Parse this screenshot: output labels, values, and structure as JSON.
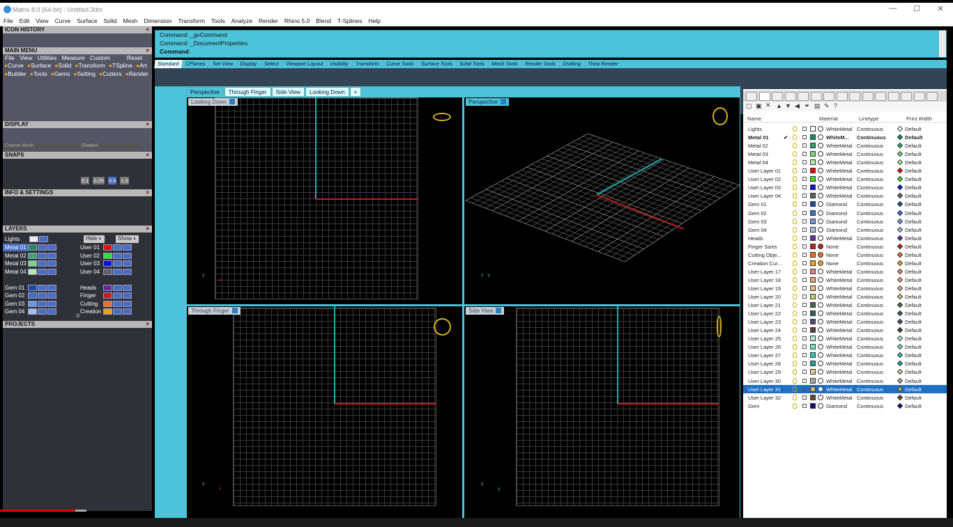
{
  "window": {
    "title": "Matrix 8.0 (64-bit) - Untitled.3dm",
    "controls": [
      "—",
      "☐",
      "✕"
    ]
  },
  "menubar": [
    "File",
    "Edit",
    "View",
    "Curve",
    "Surface",
    "Solid",
    "Mesh",
    "Dimension",
    "Transform",
    "Tools",
    "Analyze",
    "Render",
    "Rhino 5.0",
    "Blend",
    "T-Splines",
    "Help"
  ],
  "left": {
    "icon_history": "ICON HISTORY",
    "main_menu": "MAIN MENU",
    "main_menu_items": [
      "File",
      "View",
      "Utilities",
      "Measure",
      "Custom"
    ],
    "reset": "Reset",
    "menu_row2": [
      "Curve",
      "Surface",
      "Solid",
      "Transform",
      "TSpline",
      "Art"
    ],
    "menu_row3": [
      "Builder",
      "Tools",
      "Gems",
      "Setting",
      "Cutters",
      "Render"
    ],
    "display": "DISPLAY",
    "display_mode1": "Coarse Mesh",
    "display_mode2": "Shaded",
    "snaps": "SNAPS",
    "snap_values": [
      "0.1",
      "0.25",
      "0.5",
      "1.0"
    ],
    "info": "INFO & SETTINGS",
    "layers": "LAYERS",
    "lights": "Lights",
    "hide": "Hide",
    "show": "Show",
    "layer_left": [
      "Metal 01",
      "Metal 02",
      "Metal 03",
      "Metal 04",
      "",
      "Gem 01",
      "Gem 02",
      "Gem 03",
      "Gem 04"
    ],
    "layer_right": [
      "User 01",
      "User 02",
      "User 03",
      "User 04",
      "",
      "Heads",
      "Finger",
      "Cutting",
      "Creation"
    ],
    "projects": "PROJECTS"
  },
  "command": {
    "lines": [
      "Command: _gvCommand",
      "Command: _DocumentProperties",
      "Command:"
    ]
  },
  "toolbar_tabs": [
    "Standard",
    "CPlanes",
    "Set View",
    "Display",
    "Select",
    "Viewport Layout",
    "Visibility",
    "Transform",
    "Curve Tools",
    "Surface Tools",
    "Solid Tools",
    "Mesh Tools",
    "Render Tools",
    "Drafting",
    "Thea Render"
  ],
  "viewport_tabs": [
    "Perspective",
    "Through Finger",
    "Side View",
    "Looking Down",
    "+"
  ],
  "viewports": {
    "tl": {
      "label": "Looking Down",
      "ax1": "y",
      "ax2": "x"
    },
    "tr": {
      "label": "Perspective",
      "ax1": "z",
      "ax2": "y"
    },
    "bl": {
      "label": "Through Finger",
      "ax1": "z",
      "ax2": "x"
    },
    "br": {
      "label": "Side View",
      "ax1": "z",
      "ax2": "y"
    }
  },
  "layers_panel": {
    "headers": [
      "Name",
      "Material",
      "Linetype",
      "Print Width"
    ],
    "rows": [
      {
        "name": "Lights",
        "color": "#ffffff",
        "mat": "WhiteMetal",
        "lt": "Continuous",
        "pw": "Default",
        "dc": "#ffffff"
      },
      {
        "name": "Metal 01",
        "check": "✔",
        "color": "#1a8a5a",
        "mat": "WhiteM...",
        "lt": "Continuous",
        "pw": "Default",
        "dc": "#1a8a5a",
        "bold": true
      },
      {
        "name": "Metal 02",
        "color": "#2aa86a",
        "mat": "WhiteMetal",
        "lt": "Continuous",
        "pw": "Default",
        "dc": "#2aa86a"
      },
      {
        "name": "Metal 03",
        "color": "#7ad87a",
        "mat": "WhiteMetal",
        "lt": "Continuous",
        "pw": "Default",
        "dc": "#7ad87a"
      },
      {
        "name": "Metal 04",
        "color": "#b8e8a8",
        "mat": "WhiteMetal",
        "lt": "Continuous",
        "pw": "Default",
        "dc": "#b8e8a8"
      },
      {
        "name": "User Layer 01",
        "color": "#e01010",
        "mat": "WhiteMetal",
        "lt": "Continuous",
        "pw": "Default",
        "dc": "#e01010"
      },
      {
        "name": "User Layer 02",
        "color": "#30e030",
        "mat": "WhiteMetal",
        "lt": "Continuous",
        "pw": "Default",
        "dc": "#30e030"
      },
      {
        "name": "User Layer 03",
        "color": "#1010d0",
        "mat": "WhiteMetal",
        "lt": "Continuous",
        "pw": "Default",
        "dc": "#1010d0"
      },
      {
        "name": "User Layer 04",
        "color": "#606060",
        "mat": "WhiteMetal",
        "lt": "Continuous",
        "pw": "Default",
        "dc": "#606060"
      },
      {
        "name": "Gem 01",
        "color": "#1a4aa0",
        "mat": "Diamond",
        "lt": "Continuous",
        "pw": "Default",
        "dc": "#1a4aa0"
      },
      {
        "name": "Gem 02",
        "color": "#3a70c8",
        "mat": "Diamond",
        "lt": "Continuous",
        "pw": "Default",
        "dc": "#3a70c8"
      },
      {
        "name": "Gem 03",
        "color": "#6a98e0",
        "mat": "Diamond",
        "lt": "Continuous",
        "pw": "Default",
        "dc": "#6a98e0"
      },
      {
        "name": "Gem 04",
        "color": "#a8c0e8",
        "mat": "Diamond",
        "lt": "Continuous",
        "pw": "Default",
        "dc": "#a8c0e8"
      },
      {
        "name": "Heads",
        "color": "#6a2a9a",
        "mat": "WhiteMetal",
        "lt": "Continuous",
        "pw": "Default",
        "dc": "#6a2a9a"
      },
      {
        "name": "Finger Sizes",
        "color": "#c02020",
        "mat": "None",
        "lt": "Continuous",
        "pw": "Default",
        "dc": "#c02020"
      },
      {
        "name": "Cutting Obje...",
        "color": "#e87020",
        "mat": "None",
        "lt": "Continuous",
        "pw": "Default",
        "dc": "#e87020"
      },
      {
        "name": "Creation Cur...",
        "color": "#e8a020",
        "mat": "None",
        "lt": "Continuous",
        "pw": "Default",
        "dc": "#e8a020"
      },
      {
        "name": "User Layer 17",
        "color": "#e88080",
        "mat": "WhiteMetal",
        "lt": "Continuous",
        "pw": "Default",
        "dc": "#e88080"
      },
      {
        "name": "User Layer 18",
        "color": "#e8a070",
        "mat": "WhiteMetal",
        "lt": "Continuous",
        "pw": "Default",
        "dc": "#e8a070"
      },
      {
        "name": "User Layer 19",
        "color": "#e8b880",
        "mat": "WhiteMetal",
        "lt": "Continuous",
        "pw": "Default",
        "dc": "#e8b880"
      },
      {
        "name": "User Layer 20",
        "color": "#c8c870",
        "mat": "WhiteMetal",
        "lt": "Continuous",
        "pw": "Default",
        "dc": "#c8c870"
      },
      {
        "name": "User Layer 21",
        "color": "#4a6a4a",
        "mat": "WhiteMetal",
        "lt": "Continuous",
        "pw": "Default",
        "dc": "#4a6a4a"
      },
      {
        "name": "User Layer 22",
        "color": "#3a5a5a",
        "mat": "WhiteMetal",
        "lt": "Continuous",
        "pw": "Default",
        "dc": "#3a5a5a"
      },
      {
        "name": "User Layer 23",
        "color": "#4a4a6a",
        "mat": "WhiteMetal",
        "lt": "Continuous",
        "pw": "Default",
        "dc": "#4a4a6a"
      },
      {
        "name": "User Layer 24",
        "color": "#5a3a4a",
        "mat": "WhiteMetal",
        "lt": "Continuous",
        "pw": "Default",
        "dc": "#5a3a4a"
      },
      {
        "name": "User Layer 25",
        "color": "#b8e8d8",
        "mat": "WhiteMetal",
        "lt": "Continuous",
        "pw": "Default",
        "dc": "#b8e8d8"
      },
      {
        "name": "User Layer 26",
        "color": "#70e0c0",
        "mat": "WhiteMetal",
        "lt": "Continuous",
        "pw": "Default",
        "dc": "#70e0c0"
      },
      {
        "name": "User Layer 27",
        "color": "#30c0b0",
        "mat": "WhiteMetal",
        "lt": "Continuous",
        "pw": "Default",
        "dc": "#30c0b0"
      },
      {
        "name": "User Layer 28",
        "color": "#20a0a0",
        "mat": "WhiteMetal",
        "lt": "Continuous",
        "pw": "Default",
        "dc": "#20a0a0"
      },
      {
        "name": "User Layer 29",
        "color": "#e0c890",
        "mat": "WhiteMetal",
        "lt": "Continuous",
        "pw": "Default",
        "dc": "#e0c890"
      },
      {
        "name": "User Layer 30",
        "color": "#a8a8a8",
        "mat": "WhiteMetal",
        "lt": "Continuous",
        "pw": "Default",
        "dc": "#a8a8a8"
      },
      {
        "name": "User Layer 31",
        "color": "#d0b070",
        "mat": "WhiteMetal",
        "lt": "Continuous",
        "pw": "Default",
        "dc": "#d0b070",
        "selected": true
      },
      {
        "name": "User Layer 32",
        "color": "#6a4a2a",
        "mat": "WhiteMetal",
        "lt": "Continuous",
        "pw": "Default",
        "dc": "#6a4a2a"
      },
      {
        "name": "Gem",
        "color": "#10107a",
        "mat": "Diamond",
        "lt": "Continuous",
        "pw": "Default",
        "dc": "#10107a"
      }
    ]
  }
}
